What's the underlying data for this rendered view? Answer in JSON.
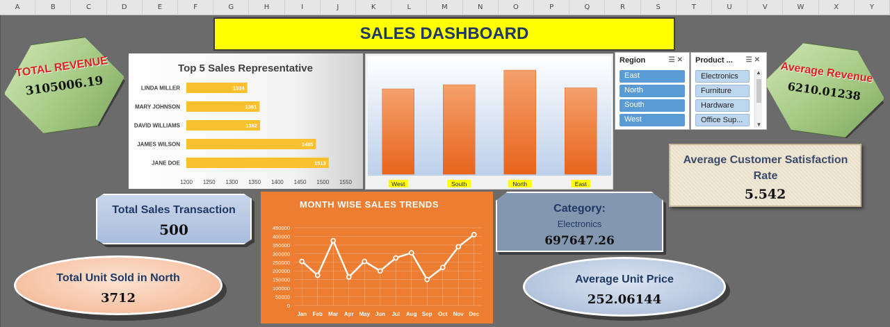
{
  "column_headers": [
    "A",
    "B",
    "C",
    "D",
    "E",
    "F",
    "G",
    "H",
    "I",
    "J",
    "K",
    "L",
    "M",
    "N",
    "O",
    "P",
    "Q",
    "R",
    "S",
    "T",
    "U",
    "V",
    "W",
    "X",
    "Y"
  ],
  "title": "SALES DASHBOARD",
  "total_revenue": {
    "label": "TOTAL REVENUE",
    "value": "3105006.19"
  },
  "average_revenue": {
    "label": "Average Revenue",
    "value": "6210.01238"
  },
  "top5_chart": {
    "title": "Top 5 Sales Representative",
    "categories": [
      "LINDA MILLER",
      "MARY JOHNSON",
      "DAVID WILLIAMS",
      "JAMES WILSON",
      "JANE DOE"
    ],
    "value_labels": [
      "1334",
      "1361",
      "1362",
      "1485",
      "1513"
    ],
    "x_ticks": [
      "1200",
      "1250",
      "1300",
      "1350",
      "1400",
      "1450",
      "1500",
      "1550"
    ]
  },
  "region_chart": {
    "categories": [
      "West",
      "South",
      "North",
      "East"
    ]
  },
  "region_slicer": {
    "title": "Region",
    "items": [
      "East",
      "North",
      "South",
      "West"
    ]
  },
  "product_slicer": {
    "title": "Product ...",
    "items": [
      "Electronics",
      "Furniture",
      "Hardware",
      "Office Sup..."
    ]
  },
  "satisfaction": {
    "label": "Average Customer Satisfaction Rate",
    "value": "5.542"
  },
  "total_transactions": {
    "label": "Total Sales Transaction",
    "value": "500"
  },
  "trend_chart": {
    "title": "MONTH WISE SALES TRENDS",
    "y_ticks": [
      "450000",
      "400000",
      "350000",
      "300000",
      "250000",
      "200000",
      "150000",
      "100000",
      "50000",
      "0"
    ],
    "months": [
      "Jan",
      "Feb",
      "Mar",
      "Apr",
      "May",
      "Jun",
      "Jul",
      "Aug",
      "Sep",
      "Oct",
      "Nov",
      "Dec"
    ]
  },
  "category": {
    "label": "Category:",
    "name": "Electronics",
    "value": "697647.26"
  },
  "units_north": {
    "label": "Total Unit Sold in North",
    "value": "3712"
  },
  "avg_unit_price": {
    "label": "Average Unit Price",
    "value": "252.06144"
  },
  "chart_data": [
    {
      "type": "bar",
      "title": "Top 5 Sales Representative",
      "orientation": "horizontal",
      "categories": [
        "LINDA MILLER",
        "MARY JOHNSON",
        "DAVID WILLIAMS",
        "JAMES WILSON",
        "JANE DOE"
      ],
      "values": [
        1334,
        1361,
        1362,
        1485,
        1513
      ],
      "xlim": [
        1200,
        1550
      ],
      "xlabel": "",
      "ylabel": "",
      "color": "#fbc02d"
    },
    {
      "type": "bar",
      "title": "",
      "categories": [
        "West",
        "South",
        "North",
        "East"
      ],
      "values": [
        820000,
        860000,
        1000000,
        830000
      ],
      "ylim": [
        0,
        1100000
      ],
      "xlabel": "",
      "ylabel": "",
      "color": "#ed7d31"
    },
    {
      "type": "line",
      "title": "MONTH WISE SALES TRENDS",
      "categories": [
        "Jan",
        "Feb",
        "Mar",
        "Apr",
        "May",
        "Jun",
        "Jul",
        "Aug",
        "Sep",
        "Oct",
        "Nov",
        "Dec"
      ],
      "values": [
        255000,
        175000,
        375000,
        165000,
        255000,
        200000,
        275000,
        305000,
        150000,
        220000,
        340000,
        410000
      ],
      "ylim": [
        0,
        450000
      ],
      "xlabel": "",
      "ylabel": "",
      "color": "#ffffff"
    }
  ]
}
